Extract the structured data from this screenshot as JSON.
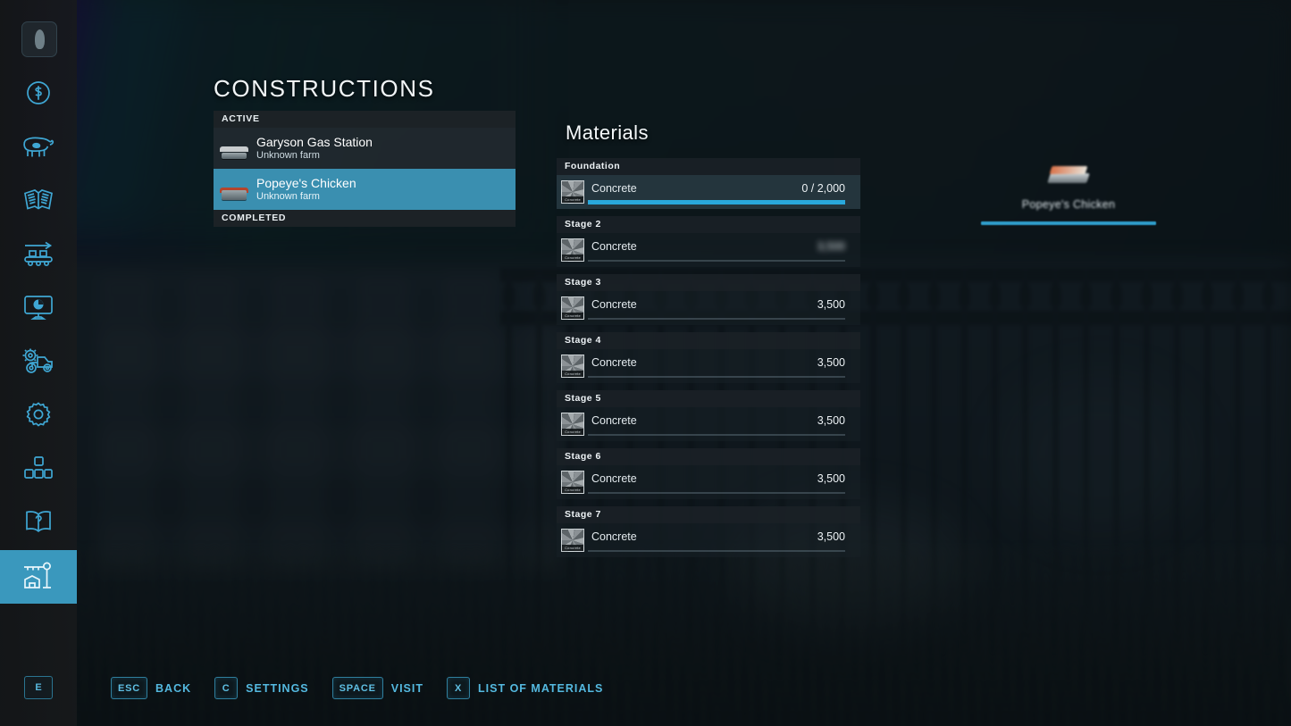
{
  "page": {
    "title": "CONSTRUCTIONS",
    "materials_title": "Materials"
  },
  "sidebar": {
    "items": [
      {
        "name": "player-avatar",
        "icon": "avatar-icon",
        "active": false
      },
      {
        "name": "finances",
        "icon": "dollar-icon",
        "active": false
      },
      {
        "name": "animals",
        "icon": "cow-icon",
        "active": false
      },
      {
        "name": "contracts",
        "icon": "documents-icon",
        "active": false
      },
      {
        "name": "production",
        "icon": "conveyor-icon",
        "active": false
      },
      {
        "name": "prices",
        "icon": "monitor-icon",
        "active": false
      },
      {
        "name": "vehicles",
        "icon": "tractor-icon",
        "active": false
      },
      {
        "name": "settings",
        "icon": "gear-icon",
        "active": false
      },
      {
        "name": "groups",
        "icon": "blocks-icon",
        "active": false
      },
      {
        "name": "help",
        "icon": "help-book-icon",
        "active": false
      },
      {
        "name": "constructions",
        "icon": "construction-icon",
        "active": true
      }
    ]
  },
  "constructions": {
    "groups": [
      {
        "label": "ACTIVE"
      },
      {
        "label": "COMPLETED"
      }
    ],
    "active_items": [
      {
        "title": "Garyson Gas Station",
        "subtitle": "Unknown farm",
        "selected": false
      },
      {
        "title": "Popeye's Chicken",
        "subtitle": "Unknown farm",
        "selected": true
      }
    ]
  },
  "materials": {
    "stages": [
      {
        "label": "Foundation",
        "highlighted": true,
        "rows": [
          {
            "icon_label": "Concrete",
            "name": "Concrete",
            "qty": "0 / 2,000",
            "progress": 100,
            "blurred": false
          }
        ]
      },
      {
        "label": "Stage 2",
        "highlighted": false,
        "rows": [
          {
            "icon_label": "Concrete",
            "name": "Concrete",
            "qty": "3,500",
            "progress": 0,
            "blurred": true
          }
        ]
      },
      {
        "label": "Stage 3",
        "highlighted": false,
        "rows": [
          {
            "icon_label": "Concrete",
            "name": "Concrete",
            "qty": "3,500",
            "progress": 0,
            "blurred": false
          }
        ]
      },
      {
        "label": "Stage 4",
        "highlighted": false,
        "rows": [
          {
            "icon_label": "Concrete",
            "name": "Concrete",
            "qty": "3,500",
            "progress": 0,
            "blurred": false
          }
        ]
      },
      {
        "label": "Stage 5",
        "highlighted": false,
        "rows": [
          {
            "icon_label": "Concrete",
            "name": "Concrete",
            "qty": "3,500",
            "progress": 0,
            "blurred": false
          }
        ]
      },
      {
        "label": "Stage 6",
        "highlighted": false,
        "rows": [
          {
            "icon_label": "Concrete",
            "name": "Concrete",
            "qty": "3,500",
            "progress": 0,
            "blurred": false
          }
        ]
      },
      {
        "label": "Stage 7",
        "highlighted": false,
        "rows": [
          {
            "icon_label": "Concrete",
            "name": "Concrete",
            "qty": "3,500",
            "progress": 0,
            "blurred": false
          }
        ]
      }
    ]
  },
  "world_marker": {
    "label": "Popeye's Chicken",
    "progress": 100
  },
  "hotkeys": {
    "interact_key": "E",
    "items": [
      {
        "key": "ESC",
        "label": "BACK"
      },
      {
        "key": "C",
        "label": "SETTINGS"
      },
      {
        "key": "SPACE",
        "label": "VISIT"
      },
      {
        "key": "X",
        "label": "LIST OF MATERIALS"
      }
    ]
  },
  "colors": {
    "accent": "#3a98bd",
    "selection": "#3a8fb0",
    "progress": "#29a8dc",
    "hotkey_text": "#54b9e0",
    "panel_bg": "#1a2126"
  }
}
